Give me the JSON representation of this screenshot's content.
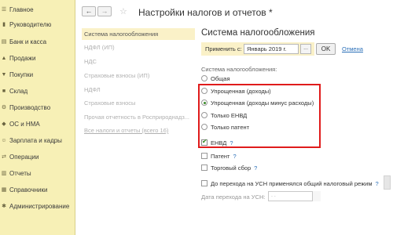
{
  "sidebar": {
    "items": [
      {
        "label": "Главное",
        "icon": "menu-icon"
      },
      {
        "label": "Руководителю",
        "icon": "chart-icon"
      },
      {
        "label": "Банк и касса",
        "icon": "bank-icon"
      },
      {
        "label": "Продажи",
        "icon": "cart-icon"
      },
      {
        "label": "Покупки",
        "icon": "basket-icon"
      },
      {
        "label": "Склад",
        "icon": "box-icon"
      },
      {
        "label": "Производство",
        "icon": "factory-icon"
      },
      {
        "label": "ОС и НМА",
        "icon": "assets-icon"
      },
      {
        "label": "Зарплата и кадры",
        "icon": "people-icon"
      },
      {
        "label": "Операции",
        "icon": "operations-icon"
      },
      {
        "label": "Отчеты",
        "icon": "report-icon"
      },
      {
        "label": "Справочники",
        "icon": "book-icon"
      },
      {
        "label": "Администрирование",
        "icon": "gear-icon"
      }
    ]
  },
  "toolbar": {
    "back": "←",
    "forward": "→",
    "star": "☆",
    "title": "Настройки налогов и отчетов *"
  },
  "list": {
    "items": [
      {
        "label": "Система налогообложения",
        "active": true
      },
      {
        "label": "НДФЛ (ИП)"
      },
      {
        "label": "НДС"
      },
      {
        "label": "Страховые взносы (ИП)"
      },
      {
        "label": "НДФЛ"
      },
      {
        "label": "Страховые взносы"
      },
      {
        "label": "Прочая отчетность в Росприроднадз..."
      },
      {
        "label": "Все налоги и отчеты (всего 16)"
      }
    ]
  },
  "panel": {
    "title": "Система налогообложения",
    "apply_label": "Применить с:",
    "date_value": "Январь 2019 г.",
    "date_dots": "...",
    "ok_label": "OK",
    "cancel_label": "Отмена",
    "system_label": "Система налогообложения:",
    "options": [
      {
        "label": "Общая",
        "selected": false
      },
      {
        "label": "Упрощенная (доходы)",
        "selected": false
      },
      {
        "label": "Упрощенная (доходы минус расходы)",
        "selected": true
      },
      {
        "label": "Только ЕНВД",
        "selected": false
      },
      {
        "label": "Только патент",
        "selected": false
      }
    ],
    "envd_label": "ЕНВД",
    "envd_checked": true,
    "help": "?",
    "patent_label": "Патент",
    "trade_fee_label": "Торговый сбор",
    "before_usn_label": "До перехода на УСН применялся общий налоговый режим",
    "transition_date_label": "Дата перехода на УСН:",
    "transition_date_value": ". ."
  },
  "colors": {
    "sidebar_bg": "#f7f0b6",
    "highlight_bg": "#faf1c8",
    "link": "#2a6fb8",
    "annotation_red": "#e01b1b"
  }
}
